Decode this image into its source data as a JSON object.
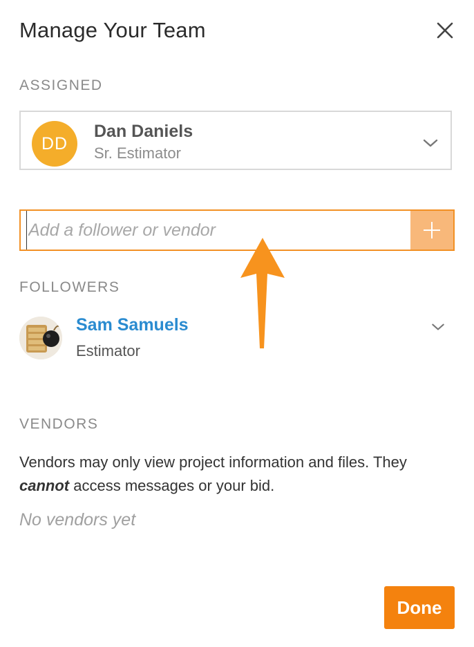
{
  "dialog": {
    "title": "Manage Your Team",
    "close_icon": "close-icon"
  },
  "assigned": {
    "section_label": "ASSIGNED",
    "user": {
      "initials": "DD",
      "name": "Dan Daniels",
      "role": "Sr. Estimator",
      "avatar_color": "#f4ad2a"
    }
  },
  "add_follower": {
    "placeholder": "Add a follower or vendor",
    "value": "",
    "button_icon": "plus-icon",
    "border_color": "#f29024",
    "button_color": "#f8b87a"
  },
  "annotation": {
    "arrow_icon": "arrow-up-icon",
    "color": "#f7931e"
  },
  "followers": {
    "section_label": "FOLLOWERS",
    "items": [
      {
        "name": "Sam Samuels",
        "role": "Estimator",
        "name_color": "#2a8bd0"
      }
    ]
  },
  "vendors": {
    "section_label": "VENDORS",
    "description_part1": "Vendors may only view project information and files. They",
    "description_emphasis": "cannot",
    "description_part2": "access messages or your bid.",
    "empty_text": "No vendors yet"
  },
  "footer": {
    "done_label": "Done",
    "done_color": "#f4820e"
  }
}
